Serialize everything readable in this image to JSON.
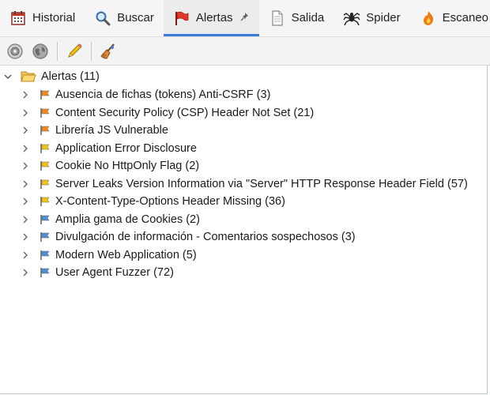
{
  "tabs": [
    {
      "label": "Historial",
      "icon": "calendar-icon"
    },
    {
      "label": "Buscar",
      "icon": "magnifier-icon"
    },
    {
      "label": "Alertas",
      "icon": "red-flag-icon",
      "active": true
    },
    {
      "label": "Salida",
      "icon": "document-icon"
    },
    {
      "label": "Spider",
      "icon": "spider-icon"
    },
    {
      "label": "Escaneo",
      "icon": "flame-icon"
    }
  ],
  "toolbar": {
    "buttons": [
      "gear-icon",
      "globe-icon",
      "pencil-icon",
      "broom-icon"
    ]
  },
  "tree": {
    "root_label": "Alertas (11)",
    "items": [
      {
        "label": "Ausencia de fichas (tokens) Anti-CSRF (3)",
        "risk": "medium"
      },
      {
        "label": "Content Security Policy (CSP) Header Not Set (21)",
        "risk": "medium"
      },
      {
        "label": "Librería JS Vulnerable",
        "risk": "medium"
      },
      {
        "label": "Application Error Disclosure",
        "risk": "low"
      },
      {
        "label": "Cookie No HttpOnly Flag (2)",
        "risk": "low"
      },
      {
        "label": "Server Leaks Version Information via \"Server\" HTTP Response Header Field (57)",
        "risk": "low"
      },
      {
        "label": "X-Content-Type-Options Header Missing (36)",
        "risk": "low"
      },
      {
        "label": "Amplia gama de Cookies (2)",
        "risk": "info"
      },
      {
        "label": "Divulgación de información - Comentarios sospechosos (3)",
        "risk": "info"
      },
      {
        "label": "Modern Web Application (5)",
        "risk": "info"
      },
      {
        "label": "User Agent Fuzzer (72)",
        "risk": "info"
      }
    ]
  },
  "colors": {
    "medium": "#f08a1c",
    "low": "#f2c511",
    "info": "#4d8fd6",
    "tab_active_underline": "#3a7bd5"
  }
}
